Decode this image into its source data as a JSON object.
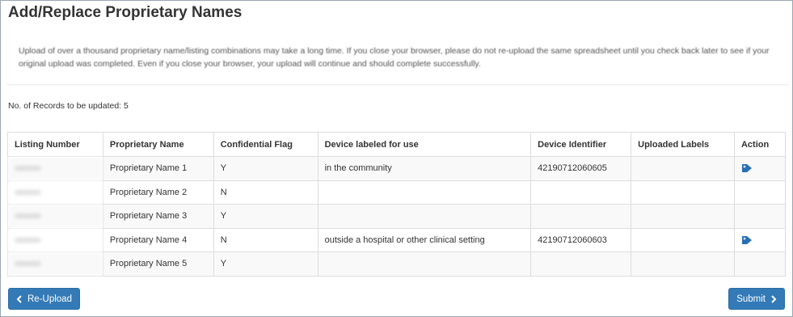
{
  "page": {
    "title": "Add/Replace Proprietary Names",
    "notice": "Upload of over a thousand proprietary name/listing combinations may take a long time. If you close your browser, please do not re-upload the same spreadsheet until you check back later to see if your original upload was completed. Even if you close your browser, your upload will continue and should complete successfully.",
    "records_label": "No. of Records to be updated:",
    "records_count": "5"
  },
  "table": {
    "headers": [
      "Listing Number",
      "Proprietary Name",
      "Confidential Flag",
      "Device labeled for use",
      "Device Identifier",
      "Uploaded Labels",
      "Action"
    ],
    "rows": [
      {
        "listing": "xxxxxxx",
        "name": "Proprietary Name 1",
        "flag": "Y",
        "use": "in the community",
        "di": "42190712060605",
        "labels": "",
        "has_action": true
      },
      {
        "listing": "xxxxxxx",
        "name": "Proprietary Name 2",
        "flag": "N",
        "use": "",
        "di": "",
        "labels": "",
        "has_action": false
      },
      {
        "listing": "xxxxxxx",
        "name": "Proprietary Name 3",
        "flag": "Y",
        "use": "",
        "di": "",
        "labels": "",
        "has_action": false
      },
      {
        "listing": "xxxxxxx",
        "name": "Proprietary Name 4",
        "flag": "N",
        "use": "outside a hospital or other clinical setting",
        "di": "42190712060603",
        "labels": "",
        "has_action": true
      },
      {
        "listing": "xxxxxxx",
        "name": "Proprietary Name 5",
        "flag": "Y",
        "use": "",
        "di": "",
        "labels": "",
        "has_action": false
      }
    ]
  },
  "buttons": {
    "reupload_label": "Re-Upload",
    "submit_label": "Submit"
  },
  "icons": {
    "action": "tag-icon",
    "reupload": "chevron-left-icon",
    "submit": "chevron-right-icon"
  },
  "colors": {
    "primary": "#337ab7",
    "tag": "#2a6fb5"
  }
}
